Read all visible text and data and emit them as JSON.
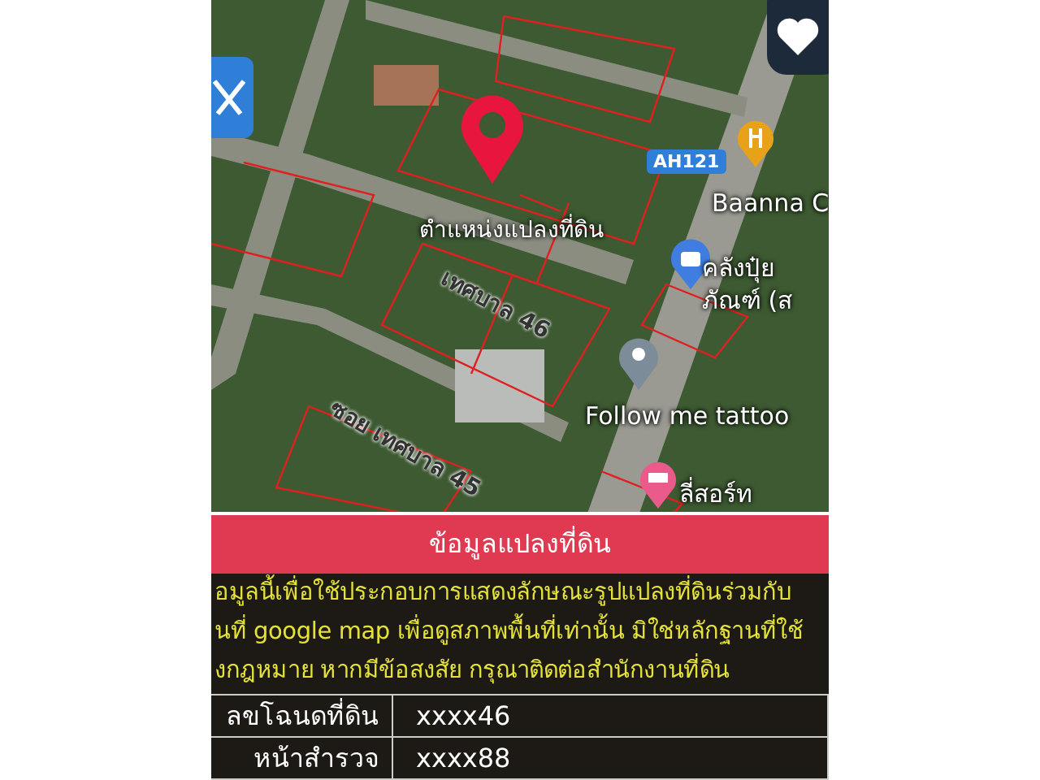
{
  "map": {
    "labels": [
      {
        "kind": "marker",
        "text": "ตำแหน่งแปลงที่ดิน"
      },
      {
        "kind": "road-shield",
        "text": "AH121"
      },
      {
        "kind": "place",
        "text": "Baanna C"
      },
      {
        "kind": "place",
        "text": "คลังปุ๋ย"
      },
      {
        "kind": "place",
        "text": "ภัณฑ์ (ส"
      },
      {
        "kind": "place",
        "text": "Follow me tattoo"
      },
      {
        "kind": "place",
        "text": "ลี่สอร์ท"
      },
      {
        "kind": "road",
        "text": "เทศบาล 46"
      },
      {
        "kind": "road",
        "text": "ซอย เทศบาล 45"
      }
    ]
  },
  "panel": {
    "title": "ข้อมูลแปลงที่ดิน",
    "notice": [
      "อมูลนี้เพื่อใช้ประกอบการแสดงลักษณะรูปแปลงที่ดินร่วมกับ",
      "นที่ google map เพื่อดูสภาพพื้นที่เท่านั้น มิใช่หลักฐานที่ใช้",
      "งกฎหมาย หากมีข้อสงสัย กรุณาติดต่อสำนักงานที่ดิน"
    ],
    "rows": [
      {
        "label": "ลขโฉนดที่ดิน",
        "value": "xxxx46"
      },
      {
        "label": "หน้าสำรวจ",
        "value": "xxxx88"
      }
    ]
  }
}
